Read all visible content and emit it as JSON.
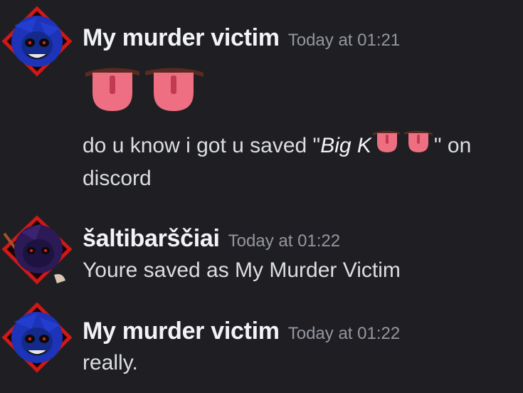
{
  "messages": [
    {
      "author": "My murder victim",
      "timestamp": "Today at 01:21",
      "emoji": "tongue-emoji",
      "line1_before": "do u know i got u saved \"",
      "line1_italic": "Big K",
      "line1_after": "\" on",
      "line2": "discord"
    },
    {
      "author": "šaltibarščiai",
      "timestamp": "Today at 01:22",
      "text": "Youre saved as My Murder Victim"
    },
    {
      "author": "My murder victim",
      "timestamp": "Today at 01:22",
      "text": "really."
    }
  ],
  "colors": {
    "background": "#1f1f23",
    "username": "#f2f3f5",
    "timestamp": "#9497a0",
    "message_text": "#dbdee1",
    "avatar_accent": "#d01818"
  }
}
